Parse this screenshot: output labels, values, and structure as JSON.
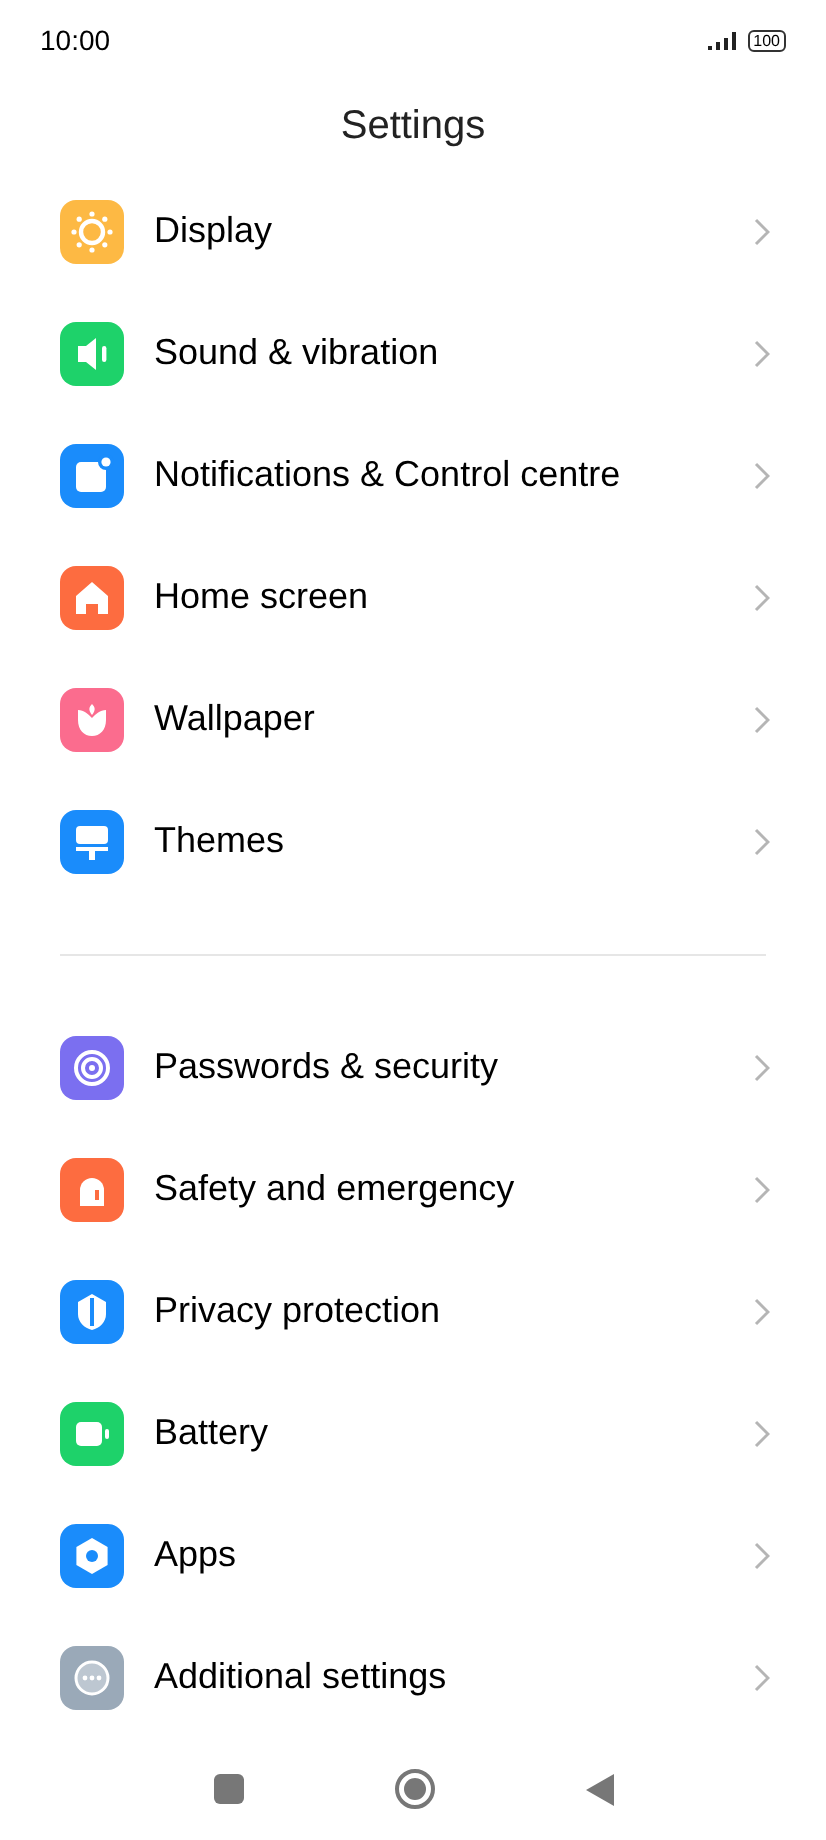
{
  "status_bar": {
    "time": "10:00",
    "battery": "100"
  },
  "title": "Settings",
  "groups": [
    {
      "items": [
        {
          "label": "Display",
          "color": "#fdb944"
        },
        {
          "label": "Sound & vibration",
          "color": "#1ed26a"
        },
        {
          "label": "Notifications & Control centre",
          "color": "#1a8cfb"
        },
        {
          "label": "Home screen",
          "color": "#fd6c40"
        },
        {
          "label": "Wallpaper",
          "color": "#fb6c8e"
        },
        {
          "label": "Themes",
          "color": "#1a8cfb"
        }
      ]
    },
    {
      "items": [
        {
          "label": "Passwords & security",
          "color": "#7b6ff0"
        },
        {
          "label": "Safety and emergency",
          "color": "#fd6c40"
        },
        {
          "label": "Privacy protection",
          "color": "#1a8cfb"
        },
        {
          "label": "Battery",
          "color": "#1ed26a"
        },
        {
          "label": "Apps",
          "color": "#1a8cfb"
        },
        {
          "label": "Additional settings",
          "color": "#9aa9b8"
        }
      ]
    }
  ]
}
